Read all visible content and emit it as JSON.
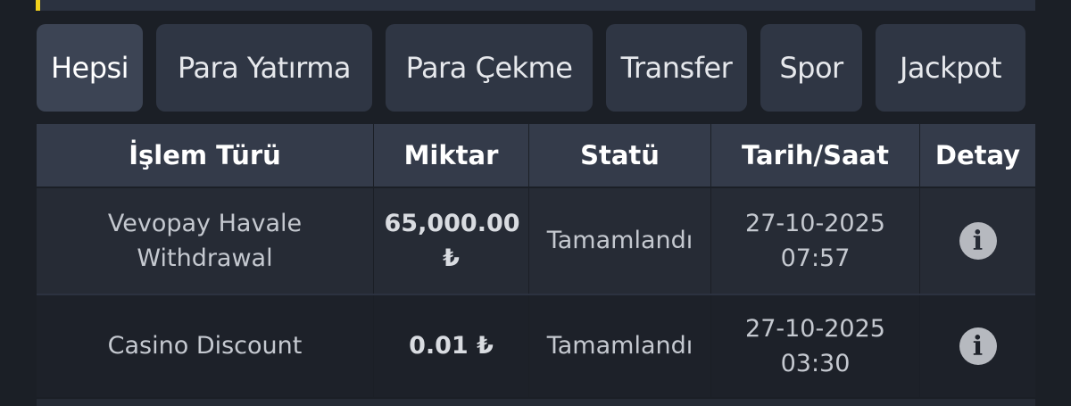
{
  "tabs": [
    {
      "label": "Hepsi",
      "active": true
    },
    {
      "label": "Para Yatırma",
      "active": false
    },
    {
      "label": "Para Çekme",
      "active": false
    },
    {
      "label": "Transfer",
      "active": false
    },
    {
      "label": "Spor",
      "active": false
    },
    {
      "label": "Jackpot",
      "active": false
    }
  ],
  "table": {
    "headers": [
      "İşlem Türü",
      "Miktar",
      "Statü",
      "Tarih/Saat",
      "Detay"
    ],
    "rows": [
      {
        "type": "Vevopay Havale Withdrawal",
        "amount": "65,000.00 ₺",
        "status": "Tamamlandı",
        "date": "27-10-2025",
        "time": "07:57",
        "detail_icon": "info-icon"
      },
      {
        "type": "Casino Discount",
        "amount": "0.01 ₺",
        "status": "Tamamlandı",
        "date": "27-10-2025",
        "time": "03:30",
        "detail_icon": "info-icon"
      }
    ]
  },
  "colors": {
    "accent": "#f2d11c",
    "background": "#1b1f26",
    "tab_bg": "#2f3644",
    "header_bg": "#343b4a"
  }
}
